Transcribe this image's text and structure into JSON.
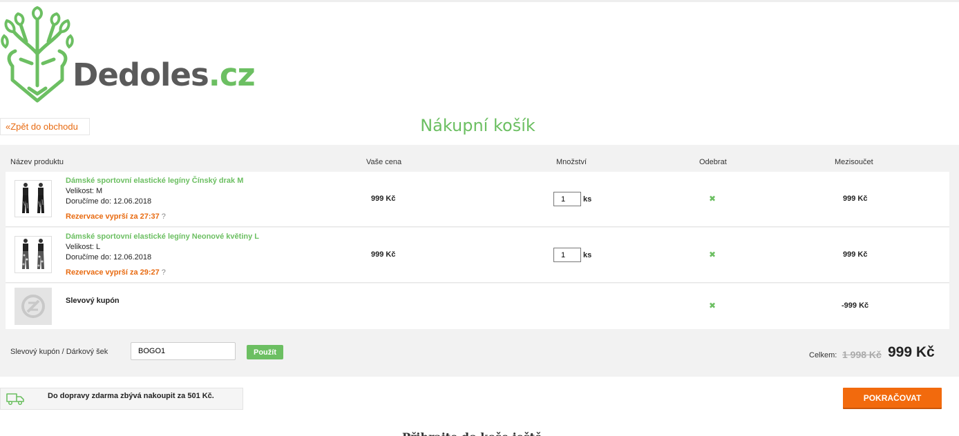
{
  "logo": {
    "name": "Dedoles",
    "domain": ".cz"
  },
  "header": {
    "back_link": "«Zpět do obchodu",
    "title": "Nákupní košík"
  },
  "columns": {
    "product": "Název produktu",
    "price": "Vaše cena",
    "quantity": "Množství",
    "remove": "Odebrat",
    "subtotal": "Mezisoučet"
  },
  "items": [
    {
      "name": "Dámské sportovní elastické legíny Čínský drak M",
      "size": "Velikost: M",
      "delivery": "Doručíme do: 12.06.2018",
      "reservation": "Rezervace vyprší za 27:37",
      "reservation_help": "?",
      "price": "999 Kč",
      "quantity": "1",
      "unit": "ks",
      "remove": "✖",
      "subtotal": "999 Kč"
    },
    {
      "name": "Dámské sportovní elastické legíny Neonové květiny L",
      "size": "Velikost: L",
      "delivery": "Doručíme do: 12.06.2018",
      "reservation": "Rezervace vyprší za 29:27",
      "reservation_help": "?",
      "price": "999 Kč",
      "quantity": "1",
      "unit": "ks",
      "remove": "✖",
      "subtotal": "999 Kč"
    }
  ],
  "coupon_row": {
    "name": "Slevový kupón",
    "remove": "✖",
    "subtotal": "-999 Kč"
  },
  "coupon_form": {
    "label": "Slevový kupón / Dárkový šek",
    "value": "BOGO1",
    "apply": "Použít"
  },
  "totals": {
    "label": "Celkem:",
    "old": "1 998 Kč",
    "new": "999 Kč"
  },
  "shipping": {
    "text": "Do dopravy zdarma zbývá nakoupit za 501 Kč."
  },
  "continue_button": "POKRAČOVAT",
  "next_section_title": "Přihrajte do koše ještě..."
}
